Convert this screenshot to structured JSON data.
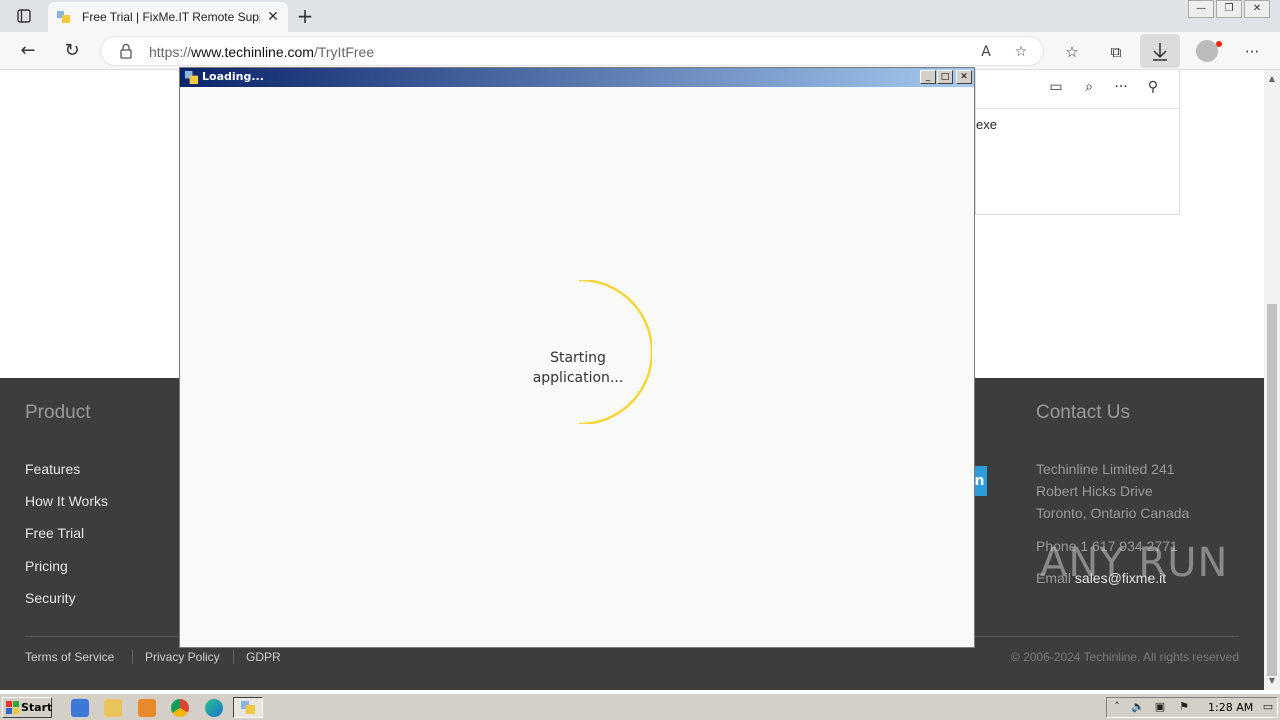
{
  "browser": {
    "tab_title": "Free Trial | FixMe.IT Remote Supp",
    "url_prefix": "https://",
    "url_domain": "www.techinline.com",
    "url_path": "/TryItFree"
  },
  "downloads_panel": {
    "file_name_fragment": "exe"
  },
  "footer": {
    "product_heading": "Product",
    "product_links": [
      "Features",
      "How It Works",
      "Free Trial",
      "Pricing",
      "Security"
    ],
    "contact_heading": "Contact Us",
    "address_lines": [
      "Techinline Limited 241",
      "Robert Hicks Drive",
      "Toronto, Ontario Canada"
    ],
    "phone": "Phone 1 617 934 2771",
    "email_label": "Email",
    "email": "sales@fixme.it",
    "linkedin_letter": "n",
    "bottom_links": [
      "Terms of Service",
      "Privacy Policy",
      "GDPR"
    ],
    "copyright": "© 2006-2024 Techinline. All rights reserved"
  },
  "dialog": {
    "title": "Loading...",
    "status_line1": "Starting",
    "status_line2": "application...",
    "spinner_color": "#f5d53a"
  },
  "taskbar": {
    "start_label": "Start",
    "clock": "1:28 AM"
  },
  "watermark": "ANY RUN"
}
